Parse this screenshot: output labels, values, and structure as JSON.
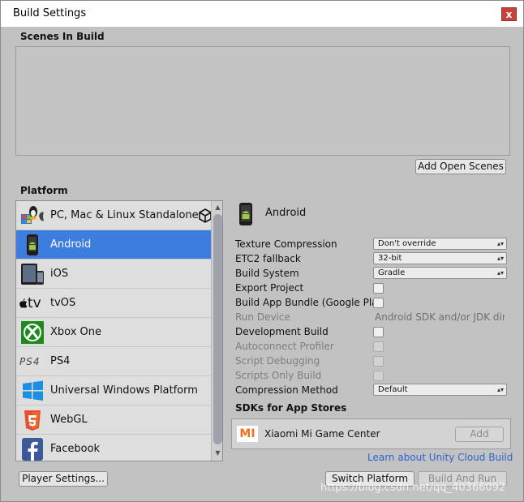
{
  "window": {
    "title": "Build Settings",
    "close_label": "x"
  },
  "scenes": {
    "title": "Scenes In Build",
    "add_open_scenes_label": "Add Open Scenes"
  },
  "platform": {
    "title": "Platform",
    "items": [
      {
        "label": "PC, Mac & Linux Standalone",
        "icon": "pc-mac-linux-icon",
        "selected": false
      },
      {
        "label": "Android",
        "icon": "android-icon",
        "selected": true
      },
      {
        "label": "iOS",
        "icon": "ios-icon",
        "selected": false
      },
      {
        "label": "tvOS",
        "icon": "tvos-icon",
        "selected": false
      },
      {
        "label": "Xbox One",
        "icon": "xbox-icon",
        "selected": false
      },
      {
        "label": "PS4",
        "icon": "ps4-icon",
        "selected": false
      },
      {
        "label": "Universal Windows Platform",
        "icon": "windows-icon",
        "selected": false
      },
      {
        "label": "WebGL",
        "icon": "html5-icon",
        "selected": false
      },
      {
        "label": "Facebook",
        "icon": "facebook-icon",
        "selected": false
      }
    ],
    "tvos_prefix": "tv",
    "ps4_text": "PS4"
  },
  "details": {
    "platform_name": "Android",
    "texture_compression": {
      "label": "Texture Compression",
      "value": "Don't override"
    },
    "etc2_fallback": {
      "label": "ETC2 fallback",
      "value": "32-bit"
    },
    "build_system": {
      "label": "Build System",
      "value": "Gradle"
    },
    "export_project": {
      "label": "Export Project"
    },
    "build_app_bundle": {
      "label": "Build App Bundle (Google Pla"
    },
    "run_device": {
      "label": "Run Device",
      "value": "Android SDK and/or JDK dir"
    },
    "development_build": {
      "label": "Development Build"
    },
    "autoconnect_profiler": {
      "label": "Autoconnect Profiler"
    },
    "script_debugging": {
      "label": "Script Debugging"
    },
    "scripts_only_build": {
      "label": "Scripts Only Build"
    },
    "compression_method": {
      "label": "Compression Method",
      "value": "Default"
    },
    "dropdown_arrow": "▴▾"
  },
  "sdks": {
    "title": "SDKs for App Stores",
    "xiaomi_label": "Xiaomi Mi Game Center",
    "xiaomi_logo_text": "MI",
    "add_label": "Add",
    "learn_link": "Learn about Unity Cloud Build"
  },
  "footer": {
    "player_settings_label": "Player Settings...",
    "switch_platform_label": "Switch Platform",
    "build_and_run_label": "Build And Run"
  },
  "watermark": "https://blog.csdn.net/qq_40366092",
  "colors": {
    "selected": "#3e7de0",
    "panel": "#c2c2c2",
    "close_button": "#c6433b",
    "link": "#2c64d0"
  }
}
